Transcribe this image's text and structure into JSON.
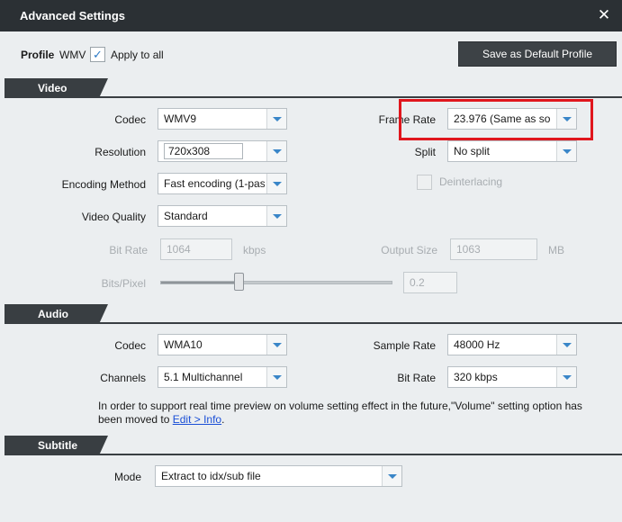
{
  "window": {
    "title": "Advanced Settings",
    "close_glyph": "✕"
  },
  "profile": {
    "label": "Profile",
    "format": "WMV",
    "apply_to_all_checked": true,
    "apply_to_all_label": "Apply to all",
    "save_default_label": "Save as Default Profile"
  },
  "video": {
    "header": "Video",
    "codec": {
      "label": "Codec",
      "value": "WMV9"
    },
    "frame_rate": {
      "label": "Frame Rate",
      "value": "23.976 (Same as so"
    },
    "resolution": {
      "label": "Resolution",
      "value": "720x308"
    },
    "split": {
      "label": "Split",
      "value": "No split"
    },
    "encoding_method": {
      "label": "Encoding Method",
      "value": "Fast encoding (1-pas"
    },
    "deinterlacing": {
      "label": "Deinterlacing",
      "checked": false
    },
    "video_quality": {
      "label": "Video Quality",
      "value": "Standard"
    },
    "bit_rate": {
      "label": "Bit Rate",
      "value": "1064",
      "unit": "kbps"
    },
    "output_size": {
      "label": "Output Size",
      "value": "1063",
      "unit": "MB"
    },
    "bits_pixel": {
      "label": "Bits/Pixel",
      "value": "0.2"
    }
  },
  "audio": {
    "header": "Audio",
    "codec": {
      "label": "Codec",
      "value": "WMA10"
    },
    "sample_rate": {
      "label": "Sample Rate",
      "value": "48000 Hz"
    },
    "channels": {
      "label": "Channels",
      "value": "5.1 Multichannel"
    },
    "bit_rate": {
      "label": "Bit Rate",
      "value": "320 kbps"
    },
    "note_text": "In order to support real time preview on volume setting effect in the future,\"Volume\" setting option has been moved to ",
    "note_link": "Edit > Info",
    "note_end": "."
  },
  "subtitle": {
    "header": "Subtitle",
    "mode": {
      "label": "Mode",
      "value": "Extract to idx/sub file"
    }
  },
  "colors": {
    "titlebar": "#2b3034",
    "section_header": "#393e42",
    "accent_arrow": "#3a86c8",
    "highlight_box": "#e0161d"
  }
}
